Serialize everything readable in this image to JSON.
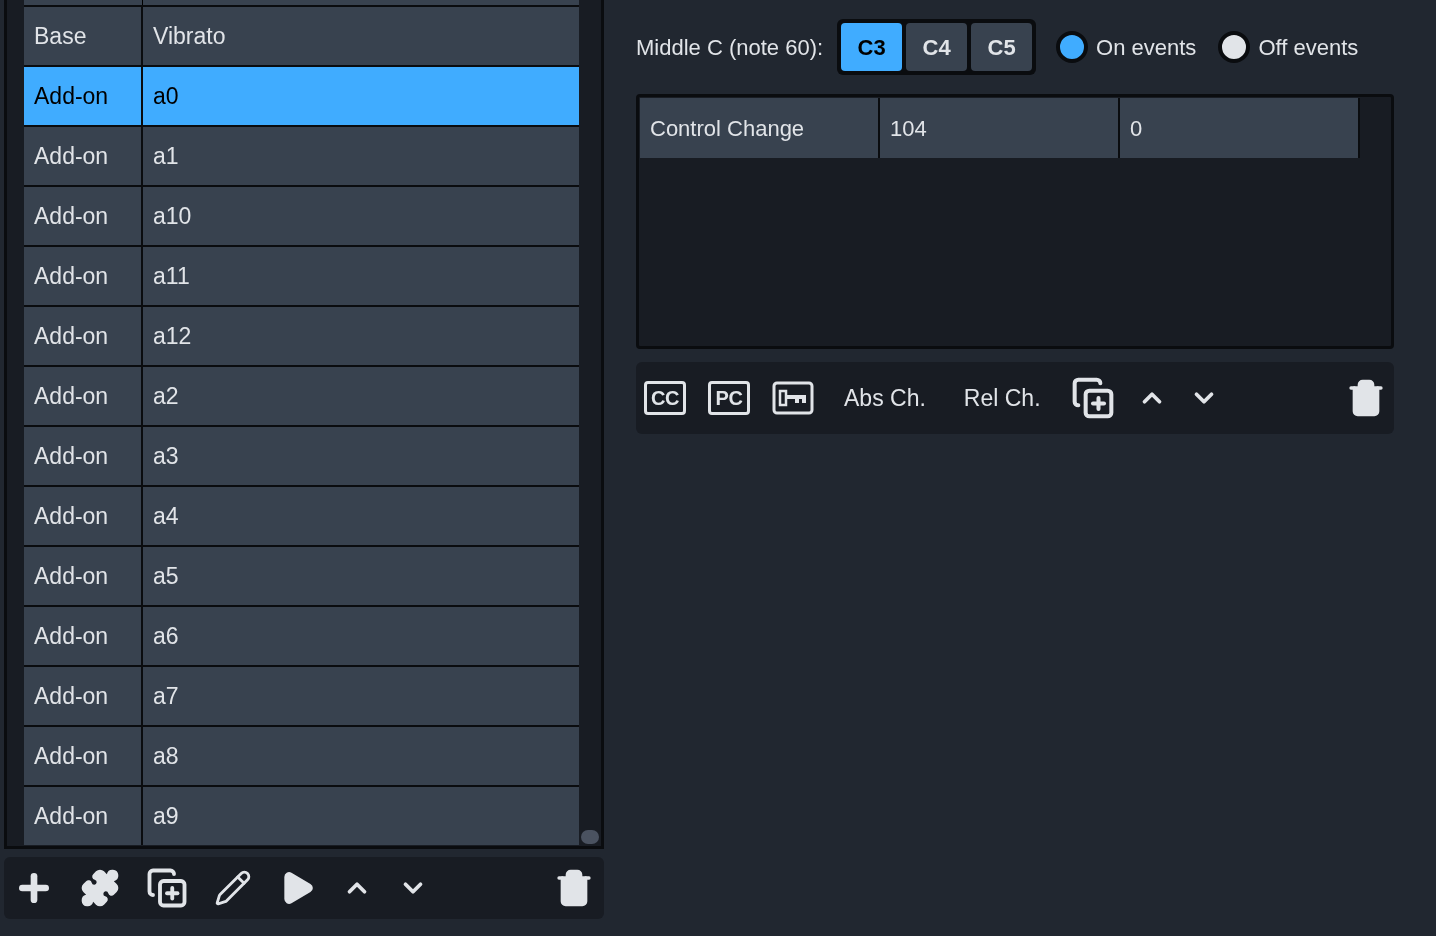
{
  "sound_list": {
    "rows": [
      {
        "cells": [
          "Base",
          "Vibrato"
        ],
        "selected": false
      },
      {
        "cells": [
          "Add-on",
          "a0"
        ],
        "selected": true
      },
      {
        "cells": [
          "Add-on",
          "a1"
        ],
        "selected": false
      },
      {
        "cells": [
          "Add-on",
          "a10"
        ],
        "selected": false
      },
      {
        "cells": [
          "Add-on",
          "a11"
        ],
        "selected": false
      },
      {
        "cells": [
          "Add-on",
          "a12"
        ],
        "selected": false
      },
      {
        "cells": [
          "Add-on",
          "a2"
        ],
        "selected": false
      },
      {
        "cells": [
          "Add-on",
          "a3"
        ],
        "selected": false
      },
      {
        "cells": [
          "Add-on",
          "a4"
        ],
        "selected": false
      },
      {
        "cells": [
          "Add-on",
          "a5"
        ],
        "selected": false
      },
      {
        "cells": [
          "Add-on",
          "a6"
        ],
        "selected": false
      },
      {
        "cells": [
          "Add-on",
          "a7"
        ],
        "selected": false
      },
      {
        "cells": [
          "Add-on",
          "a8"
        ],
        "selected": false
      },
      {
        "cells": [
          "Add-on",
          "a9"
        ],
        "selected": false
      }
    ]
  },
  "middle_c": {
    "label": "Middle C (note 60):",
    "options": [
      {
        "label": "C3",
        "selected": true
      },
      {
        "label": "C4",
        "selected": false
      },
      {
        "label": "C5",
        "selected": false
      }
    ]
  },
  "event_type": [
    {
      "label": "On events",
      "selected": true
    },
    {
      "label": "Off events",
      "selected": false
    }
  ],
  "events_table": {
    "rows": [
      {
        "cells": [
          "Control Change",
          "104",
          "0"
        ]
      }
    ]
  },
  "events_toolbar": [
    {
      "kind": "badge",
      "label": "CC"
    },
    {
      "kind": "badge",
      "label": "PC"
    },
    {
      "kind": "key"
    },
    {
      "kind": "text",
      "label": "Abs Ch."
    },
    {
      "kind": "text",
      "label": "Rel Ch."
    },
    {
      "kind": "duplicate"
    },
    {
      "kind": "up"
    },
    {
      "kind": "down"
    },
    {
      "kind": "spacer"
    },
    {
      "kind": "trash"
    }
  ]
}
